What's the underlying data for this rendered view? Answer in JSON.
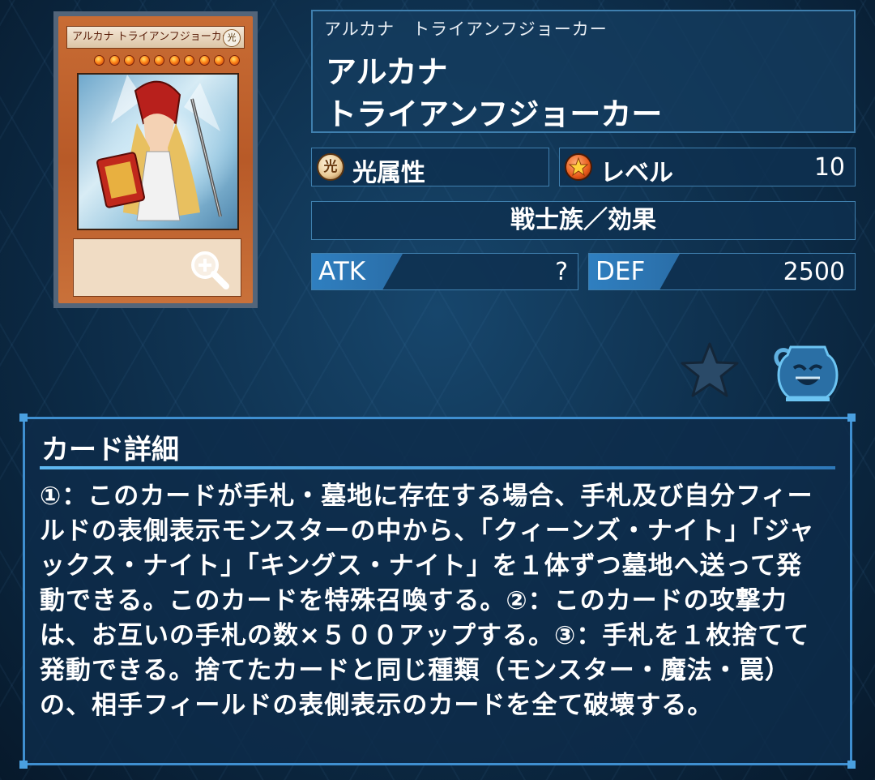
{
  "card_image": {
    "name_bar": "アルカナ トライアンフジョーカー",
    "attribute_glyph": "光",
    "star_count": 10
  },
  "header": {
    "ruby": "アルカナ　トライアンフジョーカー",
    "name_line1": "アルカナ",
    "name_line2": "トライアンフジョーカー"
  },
  "attribute": {
    "icon_glyph": "光",
    "label": "光属性"
  },
  "level": {
    "label": "レベル",
    "value": "10"
  },
  "type": {
    "label": "戦士族／効果"
  },
  "atk": {
    "label": "ATK",
    "value": "?"
  },
  "def": {
    "label": "DEF",
    "value": "2500"
  },
  "icons": {
    "favorite": "star-icon",
    "deck": "pot-icon",
    "zoom": "magnify-icon"
  },
  "details": {
    "title": "カード詳細",
    "text": "①：このカードが手札・墓地に存在する場合、手札及び自分フィールドの表側表示モンスターの中から、「クィーンズ・ナイト」「ジャックス・ナイト」「キングス・ナイト」を１体ずつ墓地へ送って発動できる。このカードを特殊召喚する。②：このカードの攻撃力は、お互いの手札の数×５００アップする。③：手札を１枚捨てて発動できる。捨てたカードと同じ種類（モンスター・魔法・罠）の、相手フィールドの表側表示のカードを全て破壊する。"
  },
  "colors": {
    "panel_border": "#3f7fae",
    "accent": "#2f7fc0",
    "background": "#0d2a45"
  }
}
